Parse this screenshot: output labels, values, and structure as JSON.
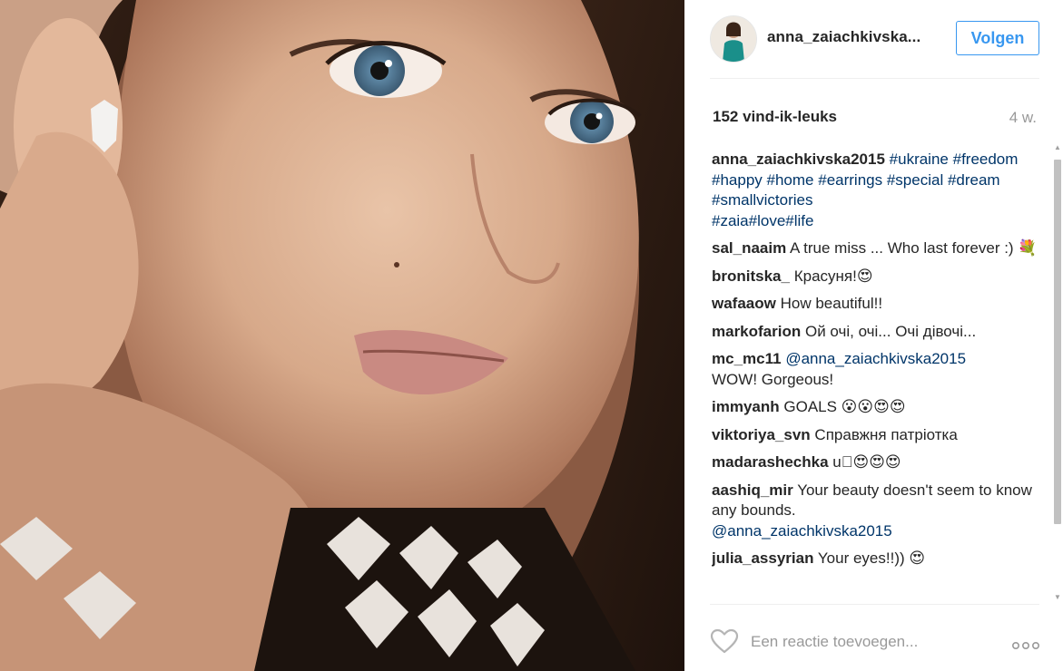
{
  "post": {
    "username": "anna_zaiachkivska...",
    "follow_label": "Volgen",
    "likes": "152 vind-ik-leuks",
    "age": "4 w."
  },
  "caption": {
    "user": "anna_zaiachkivska2015",
    "tags": [
      "#ukraine",
      "#freedom",
      "#happy",
      "#home",
      "#earrings",
      "#special",
      "#dream",
      "#smallvictories",
      "#zaia#love#life"
    ]
  },
  "comments": [
    {
      "user": "sal_naaim",
      "text": "A true miss ... Who last forever :) 💐"
    },
    {
      "user": "bronitska_",
      "text": "Красуня!😍"
    },
    {
      "user": "wafaaow",
      "text": "How beautiful!!"
    },
    {
      "user": "markofarion",
      "text": "Ой очі, очі... Очі дівочі..."
    },
    {
      "user": "mc_mc11",
      "mention": "@anna_zaiachkivska2015",
      "text": "WOW! Gorgeous!"
    },
    {
      "user": "immyanh",
      "text": "GOALS 😮😮😍😍"
    },
    {
      "user": "viktoriya_svn",
      "text": "Справжня патріотка"
    },
    {
      "user": "madarashechka",
      "text": "u🏻😍😍😍"
    },
    {
      "user": "aashiq_mir",
      "text": "Your beauty doesn't seem to know any bounds.",
      "mention": "@anna_zaiachkivska2015"
    },
    {
      "user": "julia_assyrian",
      "text": "Your eyes!!)) 😍"
    }
  ],
  "footer": {
    "placeholder": "Een reactie toevoegen...",
    "heart_icon": "heart-outline-icon",
    "more_icon": "more-options-icon"
  },
  "colors": {
    "accent": "#3897f0",
    "link": "#003569",
    "muted": "#999999",
    "text": "#262626"
  }
}
